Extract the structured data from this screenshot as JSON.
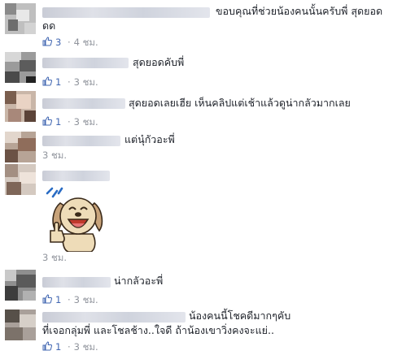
{
  "colors": {
    "link": "#4267b2",
    "meta": "#90949c",
    "text": "#1d2129"
  },
  "icons": {
    "like": "thumbs-up-icon"
  },
  "comments": [
    {
      "text_line1": "ขอบคุณที่ช่วยน้องคนนั้นครับพี่ สุดยอด",
      "text_line2": "ดด",
      "likes": "3",
      "sep": "·",
      "time": "4 ชม."
    },
    {
      "text_line1": "สุดยอดคับพี่",
      "likes": "1",
      "sep": "·",
      "time": "3 ชม."
    },
    {
      "text_line1": "สุดยอดเลยเฮีย เห็นคลิปแต่เช้าแล้วดูน่ากลัวมากเลย",
      "likes": "1",
      "sep": "·",
      "time": "3 ชม."
    },
    {
      "text_line1": "แต่นุ๋กัวอะพี่",
      "time": "3 ชม."
    },
    {
      "sticker": "laughing-dog-thumbs-up-sticker",
      "time": "3 ชม."
    },
    {
      "text_line1": "น่ากลัวอะพี่",
      "likes": "1",
      "sep": "·",
      "time": "3 ชม."
    },
    {
      "text_line1": "น้องคนนี้โชคดีมากๆคับ",
      "text_line2": "ที่เจอกลุ่มพี่ และโชลช้าง..ใจดี ถ้าน้องเขาวิ่งคงจะแย่..",
      "likes": "1",
      "sep": "·",
      "time": "3 ชม."
    }
  ]
}
